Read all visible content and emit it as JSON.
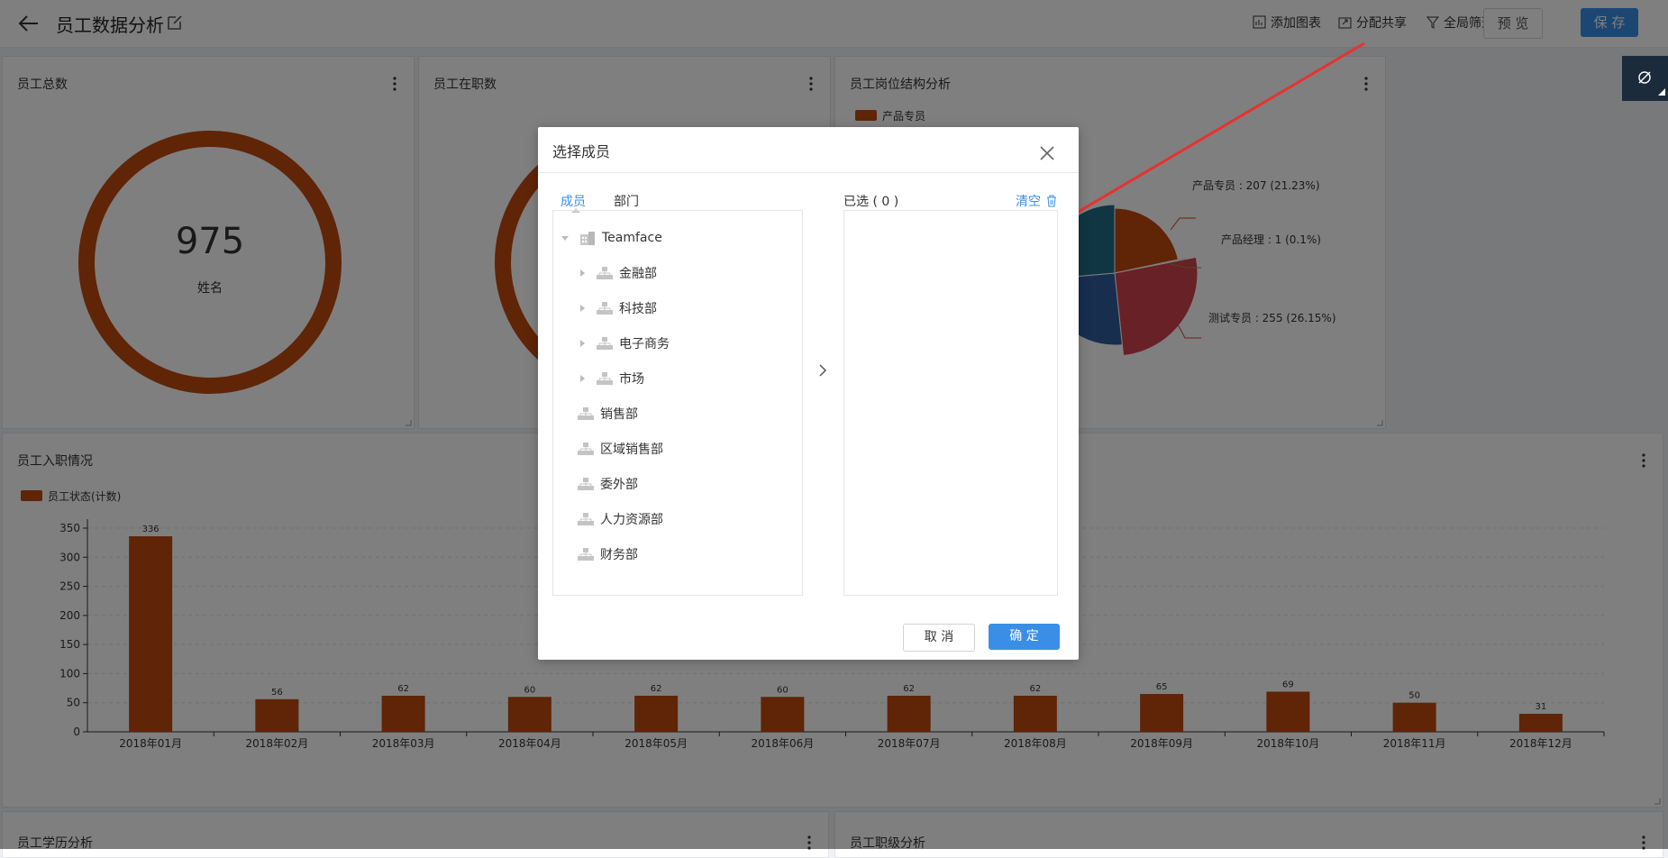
{
  "header": {
    "title": "员工数据分析",
    "actions": [
      "添加图表",
      "分配共享",
      "全局筛选"
    ],
    "preview_label": "预 览",
    "save_label": "保 存"
  },
  "cards": {
    "total": {
      "title": "员工总数",
      "value": "975",
      "sublabel": "姓名"
    },
    "active": {
      "title": "员工在职数"
    },
    "position": {
      "title": "员工岗位结构分析",
      "legend": "产品专员"
    },
    "hire": {
      "title": "员工入职情况",
      "legend": "员工状态(计数)"
    },
    "education": {
      "title": "员工学历分析"
    },
    "level": {
      "title": "员工职级分析"
    }
  },
  "colors": {
    "accent": "#3a8ee6",
    "bar": "#c0490f",
    "pie": [
      "#c0490f",
      "#d0434c",
      "#2f5c9e",
      "#216d86",
      "#8f9a3a"
    ]
  },
  "chart_data": [
    {
      "type": "bar",
      "title": "员工入职情况",
      "series": [
        {
          "name": "员工状态(计数)",
          "values": [
            336,
            56,
            62,
            60,
            62,
            60,
            62,
            62,
            65,
            69,
            50,
            31
          ]
        }
      ],
      "categories": [
        "2018年01月",
        "2018年02月",
        "2018年03月",
        "2018年04月",
        "2018年05月",
        "2018年06月",
        "2018年07月",
        "2018年08月",
        "2018年09月",
        "2018年10月",
        "2018年11月",
        "2018年12月"
      ],
      "yticks": [
        0,
        50,
        100,
        150,
        200,
        250,
        300,
        350
      ],
      "ylim": [
        0,
        350
      ],
      "grid": true,
      "legend": "top-left"
    },
    {
      "type": "pie",
      "title": "员工岗位结构分析",
      "labels": [
        "产品专员 : 207 (21.23%)",
        "产品经理 : 1 (0.1%)",
        "测试专员 : 255 (26.15%)"
      ],
      "legend": "top-left"
    }
  ],
  "dialog": {
    "title": "选择成员",
    "tabs": [
      "成员",
      "部门"
    ],
    "root": "Teamface",
    "depts_expandable": [
      "金融部",
      "科技部",
      "电子商务",
      "市场"
    ],
    "depts_leaf": [
      "销售部",
      "区域销售部",
      "委外部",
      "人力资源部",
      "财务部"
    ],
    "selected_label": "已选 ( 0 )",
    "clear_label": "清空",
    "cancel_label": "取 消",
    "ok_label": "确 定"
  }
}
